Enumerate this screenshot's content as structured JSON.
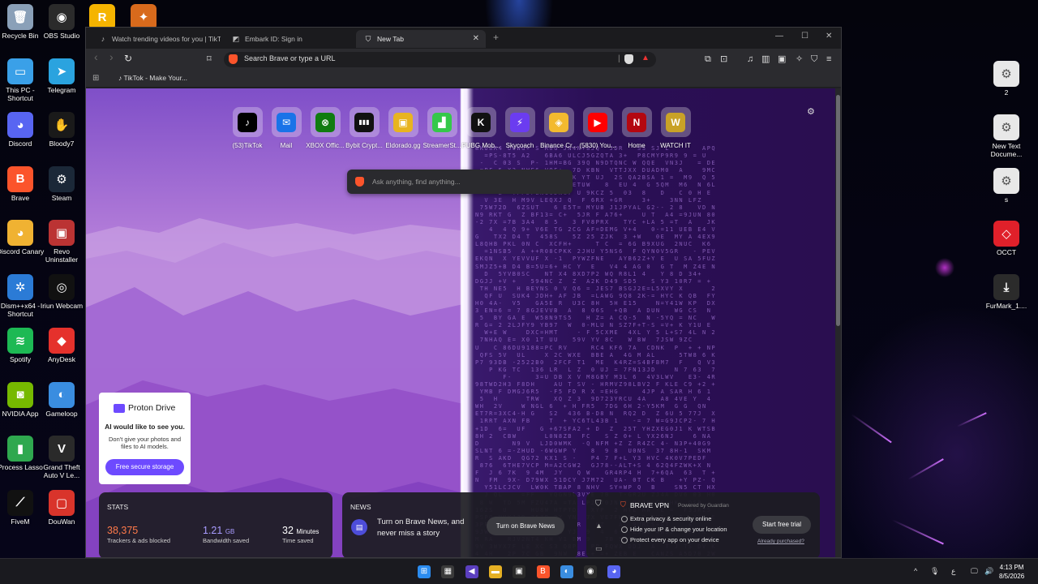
{
  "desktop": {
    "left_icons": [
      {
        "label": "Recycle Bin",
        "icon": "recycle-bin-icon",
        "color": "#8aa0b8",
        "glyph": "🗑"
      },
      {
        "label": "OBS Studio",
        "icon": "obs-icon",
        "color": "#2b2b2b",
        "glyph": "◉"
      },
      {
        "label": "This PC - Shortcut",
        "icon": "monitor-icon",
        "color": "#3aa0e8",
        "glyph": "▭"
      },
      {
        "label": "Telegram",
        "icon": "telegram-icon",
        "color": "#2aa3df",
        "glyph": "➤"
      },
      {
        "label": "Discord",
        "icon": "discord-icon",
        "color": "#5865f2",
        "glyph": "◕"
      },
      {
        "label": "Bloody7",
        "icon": "bloody7-icon",
        "color": "#1a1a1a",
        "glyph": "✋"
      },
      {
        "label": "Brave",
        "icon": "brave-icon",
        "color": "#fb542b",
        "glyph": "B"
      },
      {
        "label": "Steam",
        "icon": "steam-icon",
        "color": "#1b2838",
        "glyph": "⚙"
      },
      {
        "label": "Discord Canary",
        "icon": "discord-canary-icon",
        "color": "#f0b232",
        "glyph": "◕"
      },
      {
        "label": "Revo Uninstaller",
        "icon": "revo-icon",
        "color": "#b33",
        "glyph": "▣"
      },
      {
        "label": "Dism++x64 - Shortcut",
        "icon": "dism-icon",
        "color": "#2b7bd6",
        "glyph": "✲"
      },
      {
        "label": "Iriun Webcam",
        "icon": "webcam-icon",
        "color": "#111",
        "glyph": "◎"
      },
      {
        "label": "Spotify",
        "icon": "spotify-icon",
        "color": "#1db954",
        "glyph": "≋"
      },
      {
        "label": "AnyDesk",
        "icon": "anydesk-icon",
        "color": "#e5312c",
        "glyph": "◆"
      },
      {
        "label": "NVIDIA App",
        "icon": "nvidia-icon",
        "color": "#76b900",
        "glyph": "◙"
      },
      {
        "label": "Gameloop",
        "icon": "gameloop-icon",
        "color": "#3a8de0",
        "glyph": "◐"
      },
      {
        "label": "Process Lasso",
        "icon": "process-lasso-icon",
        "color": "#2fa84f",
        "glyph": "▮"
      },
      {
        "label": "Grand Theft Auto V Le...",
        "icon": "gta-icon",
        "color": "#2a2a2a",
        "glyph": "V"
      },
      {
        "label": "FiveM",
        "icon": "fivem-icon",
        "color": "#111",
        "glyph": "⟋"
      },
      {
        "label": "DouWan",
        "icon": "douwan-icon",
        "color": "#d9342b",
        "glyph": "▢"
      }
    ],
    "top_icons": [
      {
        "label": "",
        "icon": "rockstar-icon",
        "color": "#f5b400",
        "glyph": "R"
      },
      {
        "label": "",
        "icon": "game-launcher-icon",
        "color": "#d86a1c",
        "glyph": "✦"
      }
    ],
    "right_icons": [
      {
        "label": "2",
        "icon": "settings-file-icon",
        "color": "#e8e8e8",
        "glyph": "⚙"
      },
      {
        "label": "New Text Docume...",
        "icon": "settings-file-icon",
        "color": "#e8e8e8",
        "glyph": "⚙"
      },
      {
        "label": "s",
        "icon": "settings-file-icon",
        "color": "#e8e8e8",
        "glyph": "⚙"
      },
      {
        "label": "OCCT",
        "icon": "occt-icon",
        "color": "#e0202a",
        "glyph": "◇"
      },
      {
        "label": "FurMark_1....",
        "icon": "download-icon",
        "color": "#2b2b2b",
        "glyph": "⤓"
      }
    ]
  },
  "browser": {
    "tabs": [
      {
        "title": "Watch trending videos for you | TikTok",
        "icon": "tiktok-icon",
        "glyph": "♪",
        "active": false
      },
      {
        "title": "Embark ID: Sign in",
        "icon": "embark-icon",
        "glyph": "◩",
        "active": false
      },
      {
        "title": "New Tab",
        "icon": "brave-shield-icon",
        "glyph": "⛉",
        "active": true
      }
    ],
    "new_tab_glyph": "+",
    "window_controls": {
      "minimize": "—",
      "maximize": "☐",
      "close": "✕"
    },
    "tab_close": "✕",
    "address_placeholder": "Search Brave or type a URL",
    "nav": {
      "back": "‹",
      "forward": "›",
      "reload": "↻",
      "bookmark": "⌑"
    },
    "bookmark_bar": {
      "apps_glyph": "⊞",
      "item": "TikTok - Make Your..."
    },
    "toolbar_icons": [
      "puzzle-icon",
      "screenshot-icon",
      "media-icon",
      "sidebar-icon",
      "wallet-icon",
      "leo-icon",
      "vpn-icon",
      "menu-icon"
    ],
    "toolbar_glyphs": [
      "⧉",
      "⊡",
      "♫",
      "▥",
      "▣",
      "✧",
      "⛉",
      "≡"
    ]
  },
  "ntp": {
    "top_sites": [
      {
        "label": "(53)TikTok",
        "icon": "tiktok-icon",
        "color": "#000000",
        "glyph": "♪"
      },
      {
        "label": "Mail",
        "icon": "mail-icon",
        "color": "#1a73e8",
        "glyph": "✉"
      },
      {
        "label": "XBOX Offic...",
        "icon": "xbox-icon",
        "color": "#107c10",
        "glyph": "⊗"
      },
      {
        "label": "Bybit Crypt...",
        "icon": "bybit-icon",
        "color": "#111111",
        "glyph": "▮▮▮"
      },
      {
        "label": "Eldorado.gg",
        "icon": "eldorado-icon",
        "color": "#e8b420",
        "glyph": "▣"
      },
      {
        "label": "StreamerSt...",
        "icon": "streamer-icon",
        "color": "#35c84a",
        "glyph": "▟"
      },
      {
        "label": "PUBG Mob...",
        "icon": "kick-icon",
        "color": "#111111",
        "glyph": "K"
      },
      {
        "label": "Skycoach",
        "icon": "skycoach-icon",
        "color": "#6b3cf0",
        "glyph": "⚡"
      },
      {
        "label": "Binance Cr...",
        "icon": "binance-icon",
        "color": "#f3ba2f",
        "glyph": "◈"
      },
      {
        "label": "(5830) You...",
        "icon": "youtube-icon",
        "color": "#ff0000",
        "glyph": "▶"
      },
      {
        "label": "Home",
        "icon": "netflix-icon",
        "color": "#b40710",
        "glyph": "N"
      },
      {
        "label": "WATCH IT",
        "icon": "watchit-icon",
        "color": "#c9a227",
        "glyph": "W"
      }
    ],
    "ask_placeholder": "Ask anything, find anything...",
    "settings_glyph": "⚙",
    "proton": {
      "brand": "Proton Drive",
      "heading": "AI would like to see you.",
      "body": "Don't give your photos and files to AI models.",
      "cta": "Free secure storage"
    },
    "stats": {
      "title": "STATS",
      "trackers_value": "38,375",
      "trackers_label": "Trackers & ads blocked",
      "bandwidth_value": "1.21",
      "bandwidth_unit": "GB",
      "bandwidth_label": "Bandwidth saved",
      "time_value": "32",
      "time_unit": "Minutes",
      "time_label": "Time saved",
      "trackers_color": "#ff7a4a",
      "bandwidth_color": "#a99cff"
    },
    "news": {
      "title": "NEWS",
      "text": "Turn on Brave News, and never miss a story",
      "button": "Turn on Brave News",
      "glyph": "▤"
    },
    "vpn": {
      "title": "BRAVE VPN",
      "powered": "Powered by Guardian",
      "features": [
        "Extra privacy & security online",
        "Hide your IP & change your location",
        "Protect every app on your device"
      ],
      "button": "Start free trial",
      "link": "Already purchased?"
    }
  },
  "taskbar": {
    "apps": [
      {
        "icon": "windows-start-icon",
        "color": "#2b8cf0",
        "glyph": "⊞"
      },
      {
        "icon": "task-view-icon",
        "color": "#3a3a3a",
        "glyph": "▦"
      },
      {
        "icon": "visual-studio-icon",
        "color": "#5b3fbf",
        "glyph": "◀"
      },
      {
        "icon": "file-explorer-icon",
        "color": "#e5b024",
        "glyph": "▬"
      },
      {
        "icon": "store-icon",
        "color": "#2a2a2a",
        "glyph": "▣"
      },
      {
        "icon": "brave-icon",
        "color": "#fb542b",
        "glyph": "B"
      },
      {
        "icon": "gameloop-icon",
        "color": "#3a8de0",
        "glyph": "◐"
      },
      {
        "icon": "obs-icon",
        "color": "#2b2b2b",
        "glyph": "◉"
      },
      {
        "icon": "discord-icon",
        "color": "#5865f2",
        "glyph": "◕"
      }
    ],
    "tray": [
      "^",
      "🎙",
      "ع",
      "🖵",
      "🔊",
      "🔋"
    ],
    "time": "4:13 PM",
    "date": "8/5/2026"
  }
}
